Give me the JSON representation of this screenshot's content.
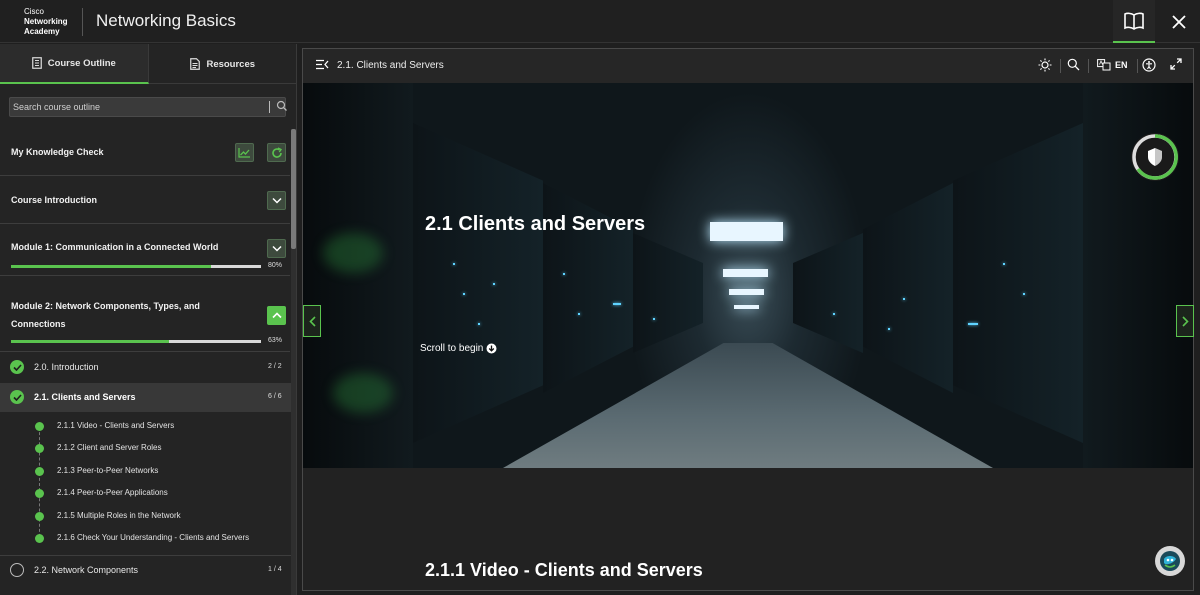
{
  "header": {
    "logo_line1": "Cisco",
    "logo_line2": "Networking",
    "logo_line3": "Academy",
    "title": "Networking Basics"
  },
  "sidebar": {
    "tabs": [
      {
        "label": "Course Outline",
        "icon": "outline-icon"
      },
      {
        "label": "Resources",
        "icon": "document-icon"
      }
    ],
    "search_placeholder": "Search course outline",
    "knowledge_check": "My Knowledge Check",
    "sections": [
      {
        "title": "Course Introduction"
      },
      {
        "title": "Module 1: Communication in a Connected World",
        "progress": "80%"
      },
      {
        "title_line1": "Module 2: Network Components, Types, and",
        "title_line2": "Connections",
        "progress": "63%"
      }
    ],
    "lessons": [
      {
        "label": "2.0. Introduction",
        "count": "2 / 2"
      },
      {
        "label": "2.1. Clients and Servers",
        "count": "6 / 6"
      },
      {
        "label": "2.2. Network Components",
        "count": "1 / 4"
      }
    ],
    "subitems": [
      "2.1.1 Video - Clients and Servers",
      "2.1.2 Client and Server Roles",
      "2.1.3 Peer-to-Peer Networks",
      "2.1.4 Peer-to-Peer Applications",
      "2.1.5 Multiple Roles in the Network",
      "2.1.6 Check Your Understanding - Clients and Servers"
    ]
  },
  "content": {
    "breadcrumb": "2.1. Clients and Servers",
    "language": "EN",
    "hero_title": "2.1 Clients and Servers",
    "scroll_hint": "Scroll to begin",
    "section_title": "2.1.1 Video - Clients and Servers"
  },
  "colors": {
    "accent": "#5ac34e",
    "background": "#1f1f1f"
  }
}
